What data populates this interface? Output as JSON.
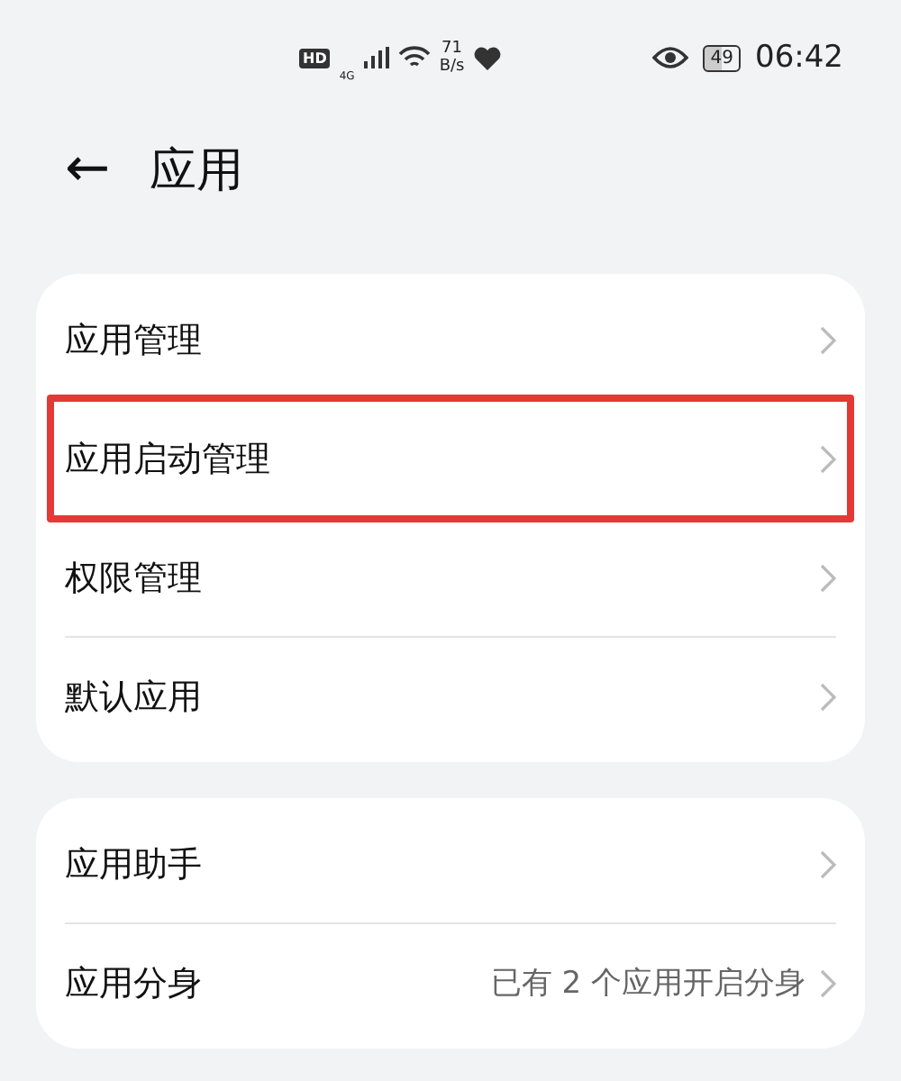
{
  "status_bar": {
    "hd": "HD",
    "network": "4G",
    "speed_value": "71",
    "speed_unit": "B/s",
    "battery": "49",
    "time": "06:42"
  },
  "header": {
    "back": "←",
    "title": "应用"
  },
  "groups": [
    {
      "items": [
        {
          "label": "应用管理",
          "highlighted": false
        },
        {
          "label": "应用启动管理",
          "highlighted": true
        },
        {
          "label": "权限管理",
          "highlighted": false
        },
        {
          "label": "默认应用",
          "highlighted": false
        }
      ]
    },
    {
      "items": [
        {
          "label": "应用助手",
          "highlighted": false
        },
        {
          "label": "应用分身",
          "value": "已有 2 个应用开启分身",
          "highlighted": false
        }
      ]
    }
  ]
}
